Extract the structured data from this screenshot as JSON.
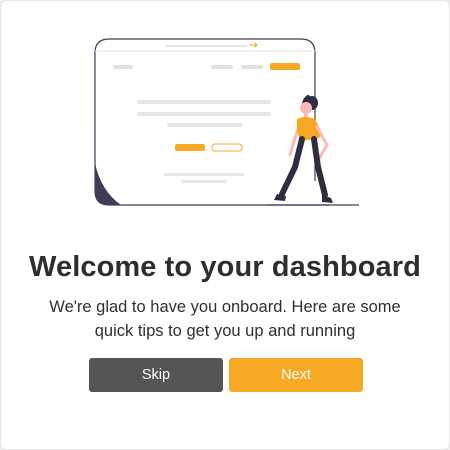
{
  "onboarding": {
    "title": "Welcome to your dashboard",
    "subtitle": "We're glad to have you onboard. Here are some quick tips to get you up and running",
    "skip_label": "Skip",
    "next_label": "Next"
  },
  "colors": {
    "accent": "#f7a825",
    "skip_button": "#555555",
    "heading": "#2e2e2e",
    "browser_dark": "#3f3d56"
  },
  "illustration": {
    "icon": "person-walking-browser-illustration"
  }
}
